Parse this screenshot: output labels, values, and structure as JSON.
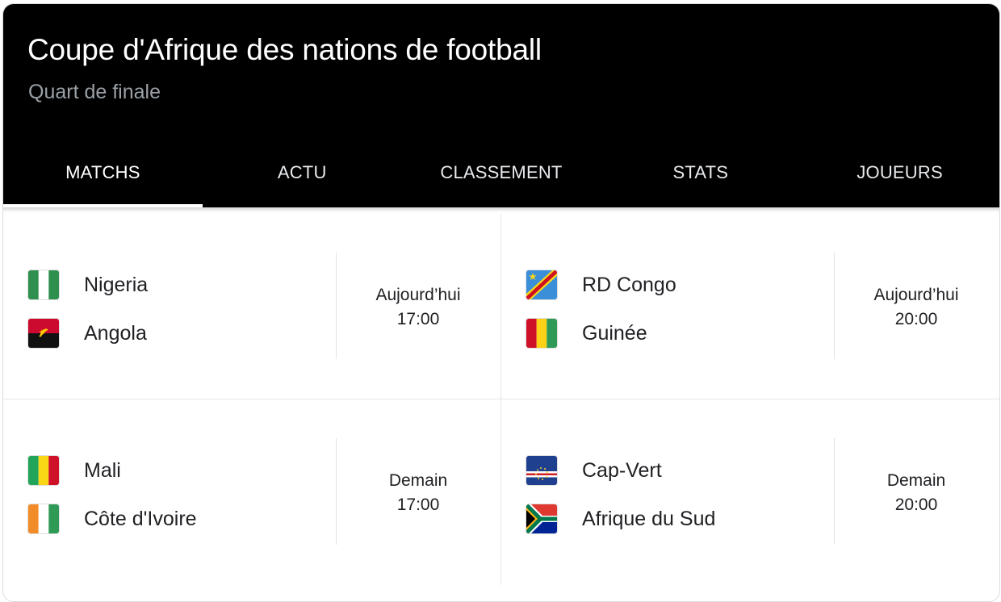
{
  "header": {
    "title": "Coupe d'Afrique des nations de football",
    "subtitle": "Quart de finale"
  },
  "tabs": [
    {
      "label": "MATCHS",
      "active": true
    },
    {
      "label": "ACTU",
      "active": false
    },
    {
      "label": "CLASSEMENT",
      "active": false
    },
    {
      "label": "STATS",
      "active": false
    },
    {
      "label": "JOUEURS",
      "active": false
    }
  ],
  "matches": [
    {
      "home": {
        "name": "Nigeria",
        "flag": "nigeria-flag"
      },
      "away": {
        "name": "Angola",
        "flag": "angola-flag"
      },
      "day": "Aujourd’hui",
      "time": "17:00"
    },
    {
      "home": {
        "name": "RD Congo",
        "flag": "dr-congo-flag"
      },
      "away": {
        "name": "Guinée",
        "flag": "guinea-flag"
      },
      "day": "Aujourd’hui",
      "time": "20:00"
    },
    {
      "home": {
        "name": "Mali",
        "flag": "mali-flag"
      },
      "away": {
        "name": "Côte d'Ivoire",
        "flag": "ivory-coast-flag"
      },
      "day": "Demain",
      "time": "17:00"
    },
    {
      "home": {
        "name": "Cap-Vert",
        "flag": "cape-verde-flag"
      },
      "away": {
        "name": "Afrique du Sud",
        "flag": "south-africa-flag"
      },
      "day": "Demain",
      "time": "20:00"
    }
  ],
  "colors": {
    "header_bg": "#000000",
    "title": "#ffffff",
    "subtitle": "#9aa0a6",
    "text": "#202124"
  }
}
